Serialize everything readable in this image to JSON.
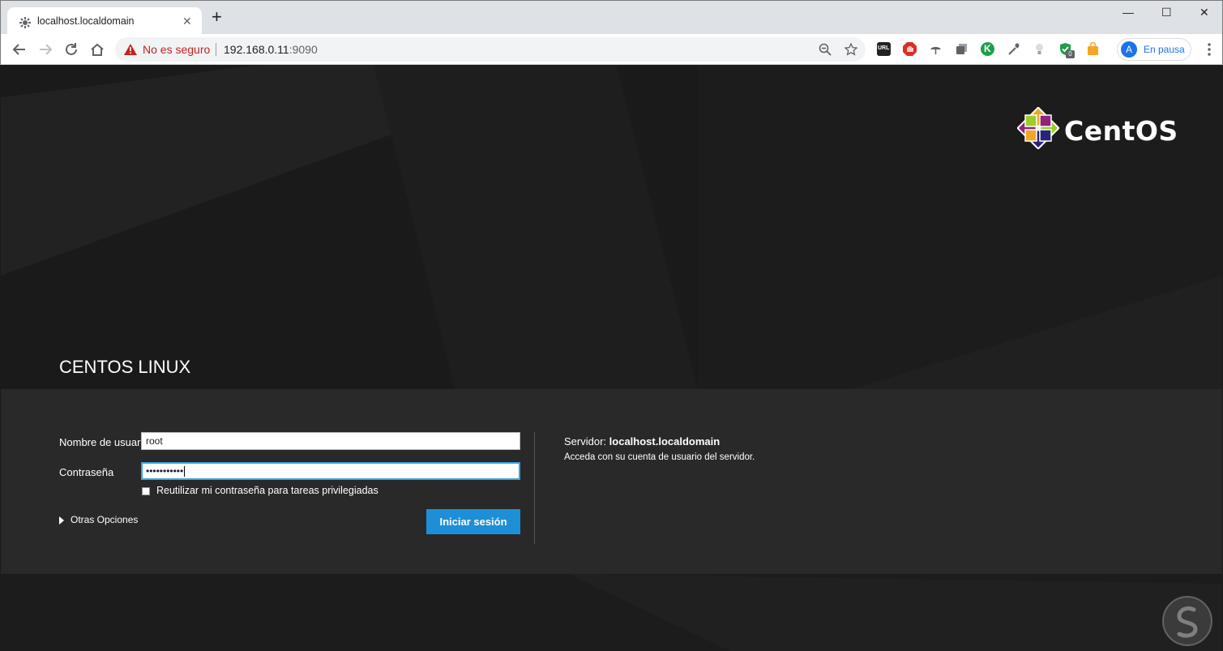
{
  "browser": {
    "tab_title": "localhost.localdomain",
    "tab_close": "✕",
    "new_tab": "+",
    "window_controls": {
      "minimize": "—",
      "maximize": "☐",
      "close": "✕"
    },
    "security_text": "No es seguro",
    "url_host": "192.168.0.11",
    "url_port": ":9090",
    "profile_initial": "A",
    "profile_label": "En pausa",
    "extensions": [
      {
        "name": "url-shortener-icon",
        "color": "#222222",
        "text": "URL"
      },
      {
        "name": "adblock-icon",
        "color": "#d93025"
      },
      {
        "name": "umbrella-icon",
        "color": "#5f6368"
      },
      {
        "name": "tabs-icon",
        "color": "#5f6368"
      },
      {
        "name": "k-extension-icon",
        "color": "#1e9e4a",
        "text": "K"
      },
      {
        "name": "eyedropper-icon",
        "color": "#5f6368"
      },
      {
        "name": "lightbulb-icon",
        "color": "#9aa0a6"
      },
      {
        "name": "shield-check-icon",
        "color": "#1e9e4a",
        "badge": "0"
      },
      {
        "name": "bag-icon",
        "color": "#f5a623"
      }
    ]
  },
  "page": {
    "brand": "CentOS",
    "os_name": "CENTOS LINUX",
    "form": {
      "username_label": "Nombre de usuario",
      "username_value": "root",
      "password_label": "Contraseña",
      "password_value": "•••••••••••",
      "reuse_password_label": "Reutilizar mi contraseña para tareas privilegiadas",
      "reuse_password_checked": false,
      "other_options": "Otras Opciones",
      "login_button": "Iniciar sesión"
    },
    "server": {
      "label": "Servidor:",
      "host": "localhost.localdomain",
      "help": "Acceda con su cuenta de usuario del servidor."
    },
    "colors": {
      "accent": "#1e8fd6",
      "focus": "#39a5dc",
      "band": "#292929"
    }
  }
}
